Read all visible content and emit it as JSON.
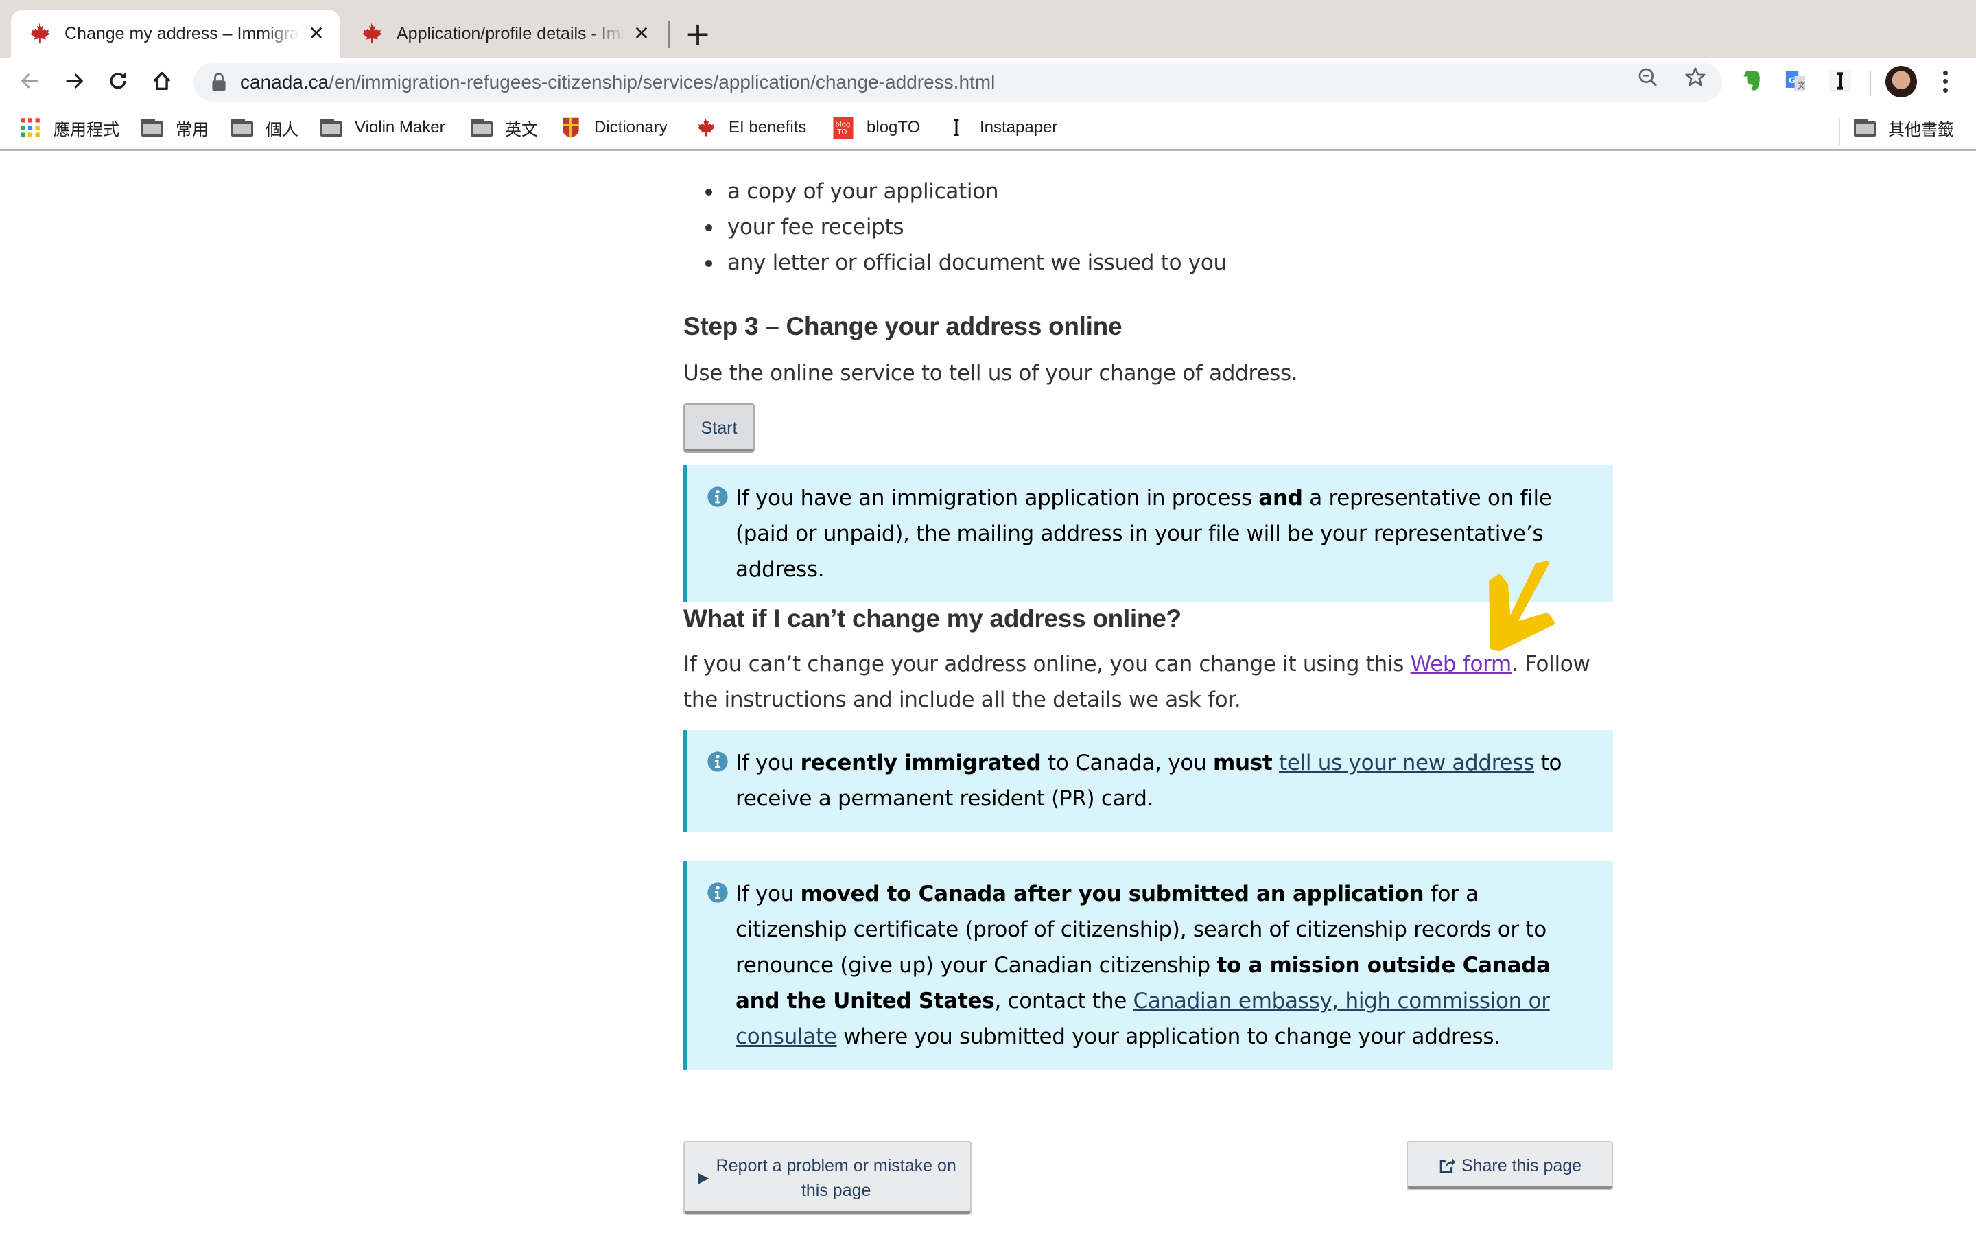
{
  "browser": {
    "tabs": [
      {
        "title": "Change my address – Immigration",
        "active": true,
        "favicon": "maple-leaf-icon"
      },
      {
        "title": "Application/profile details - Immigration",
        "active": false,
        "favicon": "maple-leaf-icon"
      }
    ],
    "close_glyph": "✕",
    "new_tab_glyph": "+",
    "url_host": "canada.ca",
    "url_path": "/en/immigration-refugees-citizenship/services/application/change-address.html",
    "extensions": [
      "evernote-icon",
      "google-translate-icon",
      "instapaper-icon"
    ],
    "bookmarks": [
      {
        "label": "應用程式",
        "icon": "apps-grid-icon"
      },
      {
        "label": "常用",
        "icon": "folder-icon"
      },
      {
        "label": "個人",
        "icon": "folder-icon"
      },
      {
        "label": "Violin Maker",
        "icon": "folder-icon"
      },
      {
        "label": "英文",
        "icon": "folder-icon"
      },
      {
        "label": "Dictionary",
        "icon": "cambridge-crest-icon"
      },
      {
        "label": "EI benefits",
        "icon": "maple-leaf-icon"
      },
      {
        "label": "blogTO",
        "icon": "blogto-icon"
      },
      {
        "label": "Instapaper",
        "icon": "instapaper-icon"
      }
    ],
    "other_bookmarks": "其他書籤"
  },
  "page": {
    "bullets": [
      "a copy of your application",
      "your fee receipts",
      "any letter or official document we issued to you"
    ],
    "step3": {
      "heading": "Step 3 – Change your address online",
      "text": "Use the online service to tell us of your change of address.",
      "start_button": "Start"
    },
    "alert1": {
      "pre": "If you have an immigration application in process ",
      "bold": "and",
      "post": " a representative on file (paid or unpaid), the mailing address in your file will be your representative’s address."
    },
    "cant_change": {
      "heading": "What if I can’t change my address online?",
      "pre": "If you can’t change your address online, you can change it using this ",
      "link": "Web form",
      "post": ". Follow the instructions and include all the details we ask for."
    },
    "alert2": {
      "t1": "If you ",
      "b1": "recently immigrated",
      "t2": " to Canada, you ",
      "b2": "must",
      "t3": " ",
      "link": "tell us your new address",
      "t4": " to receive a permanent resident (PR) card."
    },
    "alert3": {
      "t1": "If you ",
      "b1": "moved to Canada after you submitted an application",
      "t2": " for a citizenship certificate (proof of citizenship), search of citizenship records or to renounce (give up) your Canadian citizenship ",
      "b2": "to a mission outside Canada and the United States",
      "t3": ", contact the ",
      "link": "Canadian embassy, high commission or consulate",
      "t4": " where you submitted your application to change your address."
    },
    "footer": {
      "report_glyph": "▶",
      "report_label": "Report a problem or mistake on this page",
      "share_label": "Share this page"
    }
  },
  "annotation": {
    "type": "hand-drawn arrow",
    "color": "#f5c400"
  },
  "colors": {
    "link": "#284162",
    "visited_link": "#7834bc",
    "alert_bg": "#d9f4fa",
    "alert_border": "#269abc",
    "tabbar_bg": "#e3dcd9"
  }
}
